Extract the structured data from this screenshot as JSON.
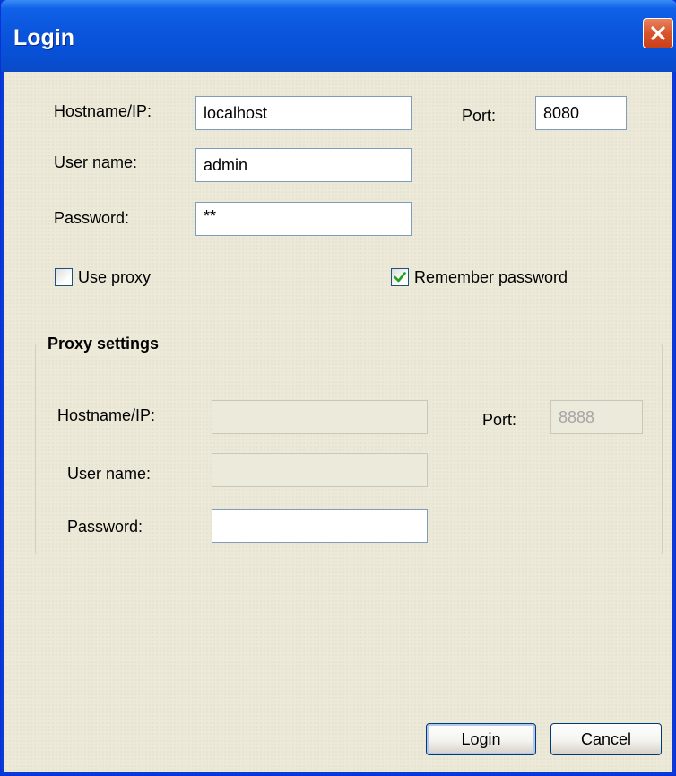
{
  "window": {
    "title": "Login"
  },
  "login": {
    "hostname_label": "Hostname/IP:",
    "hostname_value": "localhost",
    "port_label": "Port:",
    "port_value": "8080",
    "username_label": "User name:",
    "username_value": "admin",
    "password_label": "Password:",
    "password_value": "**",
    "use_proxy_label": "Use proxy",
    "use_proxy_checked": false,
    "remember_label": "Remember password",
    "remember_checked": true
  },
  "proxy": {
    "group_title": "Proxy settings",
    "hostname_label": "Hostname/IP:",
    "hostname_value": "",
    "port_label": "Port:",
    "port_value": "8888",
    "username_label": "User name:",
    "username_value": "",
    "password_label": "Password:",
    "password_value": ""
  },
  "buttons": {
    "login": "Login",
    "cancel": "Cancel"
  },
  "colors": {
    "titlebar": "#0a55dc",
    "client": "#ece9d8",
    "close": "#d9542b",
    "checkmark": "#21a121"
  }
}
